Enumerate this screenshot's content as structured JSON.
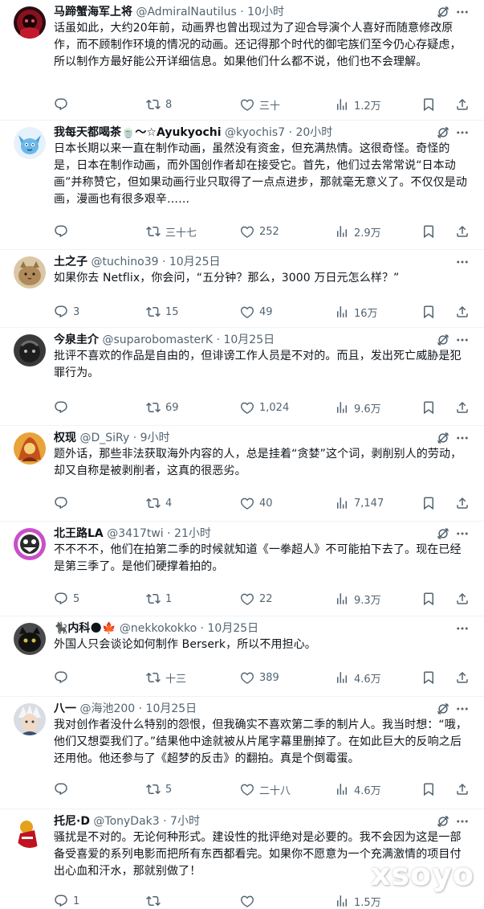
{
  "tweets": [
    {
      "name": "马蹄蟹海军上将",
      "handle": "@AdmiralNautilus",
      "dot": "·",
      "time": "10小时",
      "text": "话虽如此，大约20年前，动画界也曾出现过为了迎合导演个人喜好而随意修改原作，而不顾制作环境的情况的动画。还记得那个时代的御宅族们至今仍心存疑虑，所以制作方最好能公开详细信息。如果他们什么都不说，他们也不会理解。",
      "replies": "",
      "retweets": "8",
      "likes": "三十",
      "views": "1.2万"
    },
    {
      "name": "我每天都喝茶🍵〜☆Ayukyochi",
      "handle": "@kyochis7",
      "dot": "·",
      "time": "20小时",
      "text": "日本长期以来一直在制作动画，虽然没有资金，但充满热情。这很奇怪。奇怪的是，日本在制作动画，而外国创作者却在接受它。首先，他们过去常常说“日本动画”并称赞它，但如果动画行业只取得了一点点进步，那就毫无意义了。不仅仅是动画，漫画也有很多艰辛……",
      "replies": "",
      "retweets": "三十七",
      "likes": "252",
      "views": "2.9万"
    },
    {
      "name": "土之子",
      "handle": "@tuchino39",
      "dot": "·",
      "time": "10月25日",
      "text": "如果你去 Netflix，你会问，“五分钟？那么，3000 万日元怎么样？”",
      "replies": "3",
      "retweets": "15",
      "likes": "49",
      "views": "16万"
    },
    {
      "name": "今泉圭介",
      "handle": "@suparobomasterK",
      "dot": "·",
      "time": "10月25日",
      "text": "批评不喜欢的作品是自由的，但诽谤工作人员是不对的。而且，发出死亡威胁是犯罪行为。",
      "replies": "",
      "retweets": "69",
      "likes": "1,024",
      "views": "9.6万"
    },
    {
      "name": "权现",
      "handle": "@D_SiRy",
      "dot": "·",
      "time": "9小时",
      "text": "题外话，那些非法获取海外内容的人，总是挂着“贪婪”这个词，剥削别人的劳动，却又自称是被剥削者，这真的很恶劣。",
      "replies": "",
      "retweets": "4",
      "likes": "40",
      "views": "7,147"
    },
    {
      "name": "北王路LA",
      "handle": "@3417twi",
      "dot": "·",
      "time": "21小时",
      "text": "不不不不，他们在拍第二季的时候就知道《一拳超人》不可能拍下去了。现在已经是第三季了。是他们硬撑着拍的。",
      "replies": "5",
      "retweets": "1",
      "likes": "22",
      "views": "9.3万"
    },
    {
      "name": "🐈‍⬛内科🌑🍁",
      "handle": "@nekkokokko",
      "dot": "·",
      "time": "10月25日",
      "text": "外国人只会谈论如何制作 Berserk，所以不用担心。",
      "replies": "",
      "retweets": "十三",
      "likes": "389",
      "views": "4.6万"
    },
    {
      "name": "八一",
      "handle": "@海池200",
      "dot": "·",
      "time": "10月25日",
      "text": "我对创作者没什么特别的怨恨，但我确实不喜欢第二季的制片人。我当时想：“哦，他们又想耍我们了。”结果他中途就被从片尾字幕里删掉了。在如此巨大的反响之后还用他。他还参与了《超梦的反击》的翻拍。真是个倒霉蛋。",
      "replies": "",
      "retweets": "5",
      "likes": "二十八",
      "views": "4.6万"
    },
    {
      "name": "托尼·D",
      "handle": "@TonyDak3",
      "dot": "·",
      "time": "7小时",
      "text": "骚扰是不对的。无论何种形式。建设性的批评绝对是必要的。我不会因为这是一部备受喜爱的系列电影而把所有东西都看完。如果你不愿意为一个充满激情的项目付出心血和汗水，那就别做了！",
      "replies": "1",
      "retweets": "",
      "likes": "",
      "views": "1.5万"
    }
  ],
  "icons": {
    "reply": "reply-icon",
    "retweet": "retweet-icon",
    "like": "heart-icon",
    "views": "views-icon",
    "bookmark": "bookmark-icon",
    "share": "share-icon",
    "grok": "grok-icon",
    "more": "more-icon"
  },
  "colors": {
    "text": "#0f1419",
    "secondary": "#536471",
    "divider": "#eff3f4"
  },
  "watermark": "xsoyo"
}
